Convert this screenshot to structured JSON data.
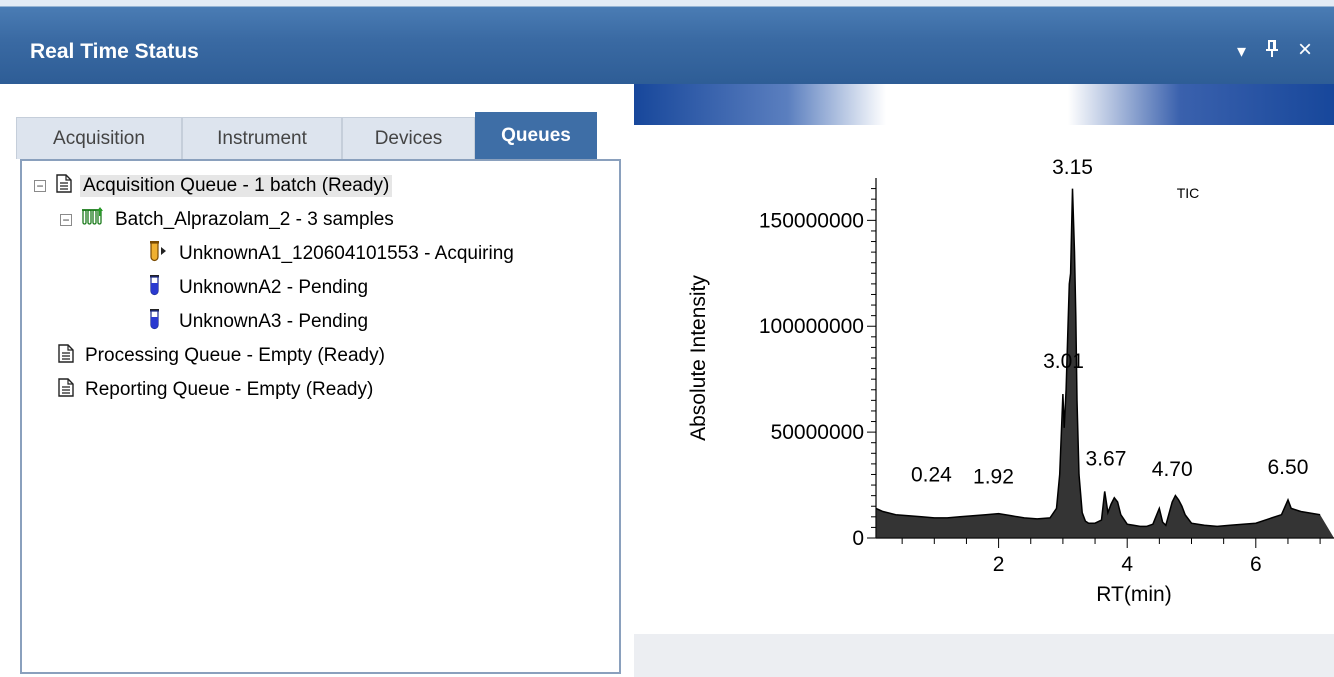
{
  "window": {
    "title": "Real Time Status",
    "dropdown_glyph": "▾",
    "pin_glyph": "ᚮ",
    "close_glyph": "×"
  },
  "tabs": [
    {
      "label": "Acquisition",
      "active": false
    },
    {
      "label": "Instrument",
      "active": false
    },
    {
      "label": "Devices",
      "active": false
    },
    {
      "label": "Queues",
      "active": true
    }
  ],
  "tree": {
    "acquisition_queue": "Acquisition Queue - 1 batch (Ready)",
    "batch": "Batch_Alprazolam_2 - 3 samples",
    "samples": [
      {
        "label": "UnknownA1_120604101553 - Acquiring",
        "icon": "vial-acquiring-icon"
      },
      {
        "label": "UnknownA2 - Pending",
        "icon": "vial-pending-icon"
      },
      {
        "label": "UnknownA3 - Pending",
        "icon": "vial-pending-icon"
      }
    ],
    "processing_queue": "Processing Queue - Empty (Ready)",
    "reporting_queue": "Reporting Queue - Empty (Ready)"
  },
  "chart_data": {
    "type": "line",
    "title": "TIC",
    "xlabel": "RT(min)",
    "ylabel": "Absolute Intensity",
    "xlim": [
      0,
      7.0
    ],
    "ylim": [
      0,
      170000000
    ],
    "x_ticks": [
      2,
      4,
      6
    ],
    "y_ticks": [
      0,
      50000000,
      100000000,
      150000000
    ],
    "y_tick_labels": [
      "0",
      "50000000",
      "100000000",
      "150000000"
    ],
    "series": [
      {
        "x": [
          0.0,
          0.2,
          0.4,
          0.6,
          0.8,
          1.0,
          1.2,
          1.4,
          1.6,
          1.8,
          2.0,
          2.2,
          2.4,
          2.6,
          2.8,
          2.9,
          2.95,
          3.0,
          3.02,
          3.05,
          3.08,
          3.1,
          3.12,
          3.15,
          3.18,
          3.2,
          3.22,
          3.25,
          3.3,
          3.35,
          3.4,
          3.5,
          3.6,
          3.65,
          3.7,
          3.75,
          3.8,
          3.85,
          3.9,
          4.0,
          4.1,
          4.2,
          4.3,
          4.4,
          4.5,
          4.55,
          4.6,
          4.7,
          4.75,
          4.8,
          4.85,
          4.9,
          5.0,
          5.1,
          5.2,
          5.4,
          5.6,
          5.8,
          6.0,
          6.2,
          6.4,
          6.5,
          6.55,
          6.7,
          7.0
        ],
        "y": [
          14000000,
          12500000,
          11000000,
          10500000,
          10000000,
          9500000,
          9500000,
          10000000,
          10500000,
          11000000,
          11500000,
          10500000,
          9500000,
          9000000,
          9500000,
          14000000,
          30000000,
          68000000,
          52000000,
          70000000,
          100000000,
          120000000,
          125000000,
          165000000,
          135000000,
          105000000,
          65000000,
          30000000,
          12000000,
          8000000,
          7000000,
          7000000,
          8500000,
          22000000,
          12000000,
          16000000,
          19000000,
          17000000,
          11000000,
          6500000,
          6000000,
          5500000,
          5500000,
          6500000,
          14000000,
          7500000,
          6000000,
          17000000,
          20000000,
          18000000,
          15000000,
          11000000,
          7000000,
          6500000,
          6000000,
          5500000,
          6000000,
          6500000,
          7000000,
          9000000,
          11000000,
          18000000,
          14000000,
          12500000,
          11000000
        ]
      }
    ],
    "peak_labels": [
      {
        "x": 0.24,
        "text": "0.24"
      },
      {
        "x": 1.92,
        "text": "1.92"
      },
      {
        "x": 3.01,
        "text": "3.01"
      },
      {
        "x": 3.15,
        "text": "3.15"
      },
      {
        "x": 3.67,
        "text": "3.67"
      },
      {
        "x": 4.7,
        "text": "4.70"
      },
      {
        "x": 6.5,
        "text": "6.50"
      }
    ],
    "grid": false
  }
}
